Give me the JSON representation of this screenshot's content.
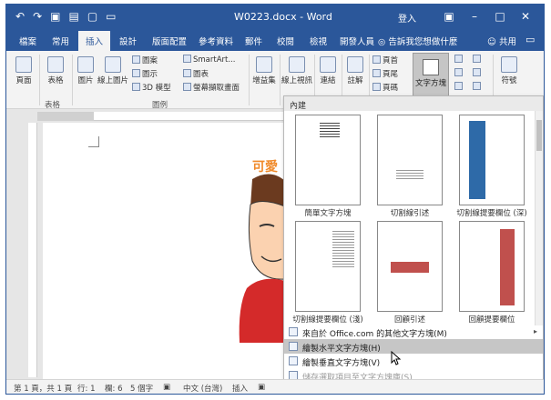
{
  "titlebar": {
    "title": "W0223.docx - Word",
    "login": "登入",
    "qat_icons": [
      "undo-icon",
      "redo-icon",
      "save-icon",
      "undo-save-icon",
      "new-doc-icon",
      "open-icon"
    ]
  },
  "tabs": {
    "file": "檔案",
    "home": "常用",
    "insert": "插入",
    "design": "設計",
    "layout": "版面配置",
    "references": "參考資料",
    "mailings": "郵件",
    "review": "校閱",
    "view": "檢視",
    "developer": "開發人員",
    "tell": "告訴我您想做什麼",
    "share": "共用"
  },
  "ribbon": {
    "pages": "頁面",
    "table": "表格",
    "table_group": "表格",
    "pictures": "圖片",
    "online_pictures": "線上圖片",
    "shapes": "圖案",
    "icons": "圖示",
    "models_3d": "3D 模型",
    "smartart": "SmartArt...",
    "chart": "圖表",
    "screenshot": "螢幕擷取畫面",
    "illustrations_group": "圖例",
    "addins": "增益集",
    "online_video": "線上視訊",
    "links": "連結",
    "comment": "註解",
    "header": "頁首",
    "footer": "頁尾",
    "page_number": "頁碼",
    "textbox": "文字方塊",
    "symbols": "符號"
  },
  "document": {
    "watermark_text": "可愛"
  },
  "gallery": {
    "section": "內建",
    "items": [
      "簡單文字方塊",
      "切割線引述",
      "切割線提要欄位 (深)",
      "切割線提要欄位 (淺)",
      "回顧引述",
      "回顧提要欄位"
    ],
    "colors": {
      "blue_bar": "#2e6aa8",
      "red_bar": "#c0504d"
    }
  },
  "menu": {
    "more": "來自於 Office.com 的其他文字方塊(M)",
    "draw_horizontal": "繪製水平文字方塊(H)",
    "draw_vertical": "繪製垂直文字方塊(V)",
    "save_selection": "儲存選取項目至文字方塊庫(S)"
  },
  "status": {
    "page": "第 1 頁，共 1 頁",
    "line": "行: 1",
    "column": "欄: 6",
    "chars": "5 個字",
    "language": "中文 (台灣)",
    "mode": "插入"
  }
}
